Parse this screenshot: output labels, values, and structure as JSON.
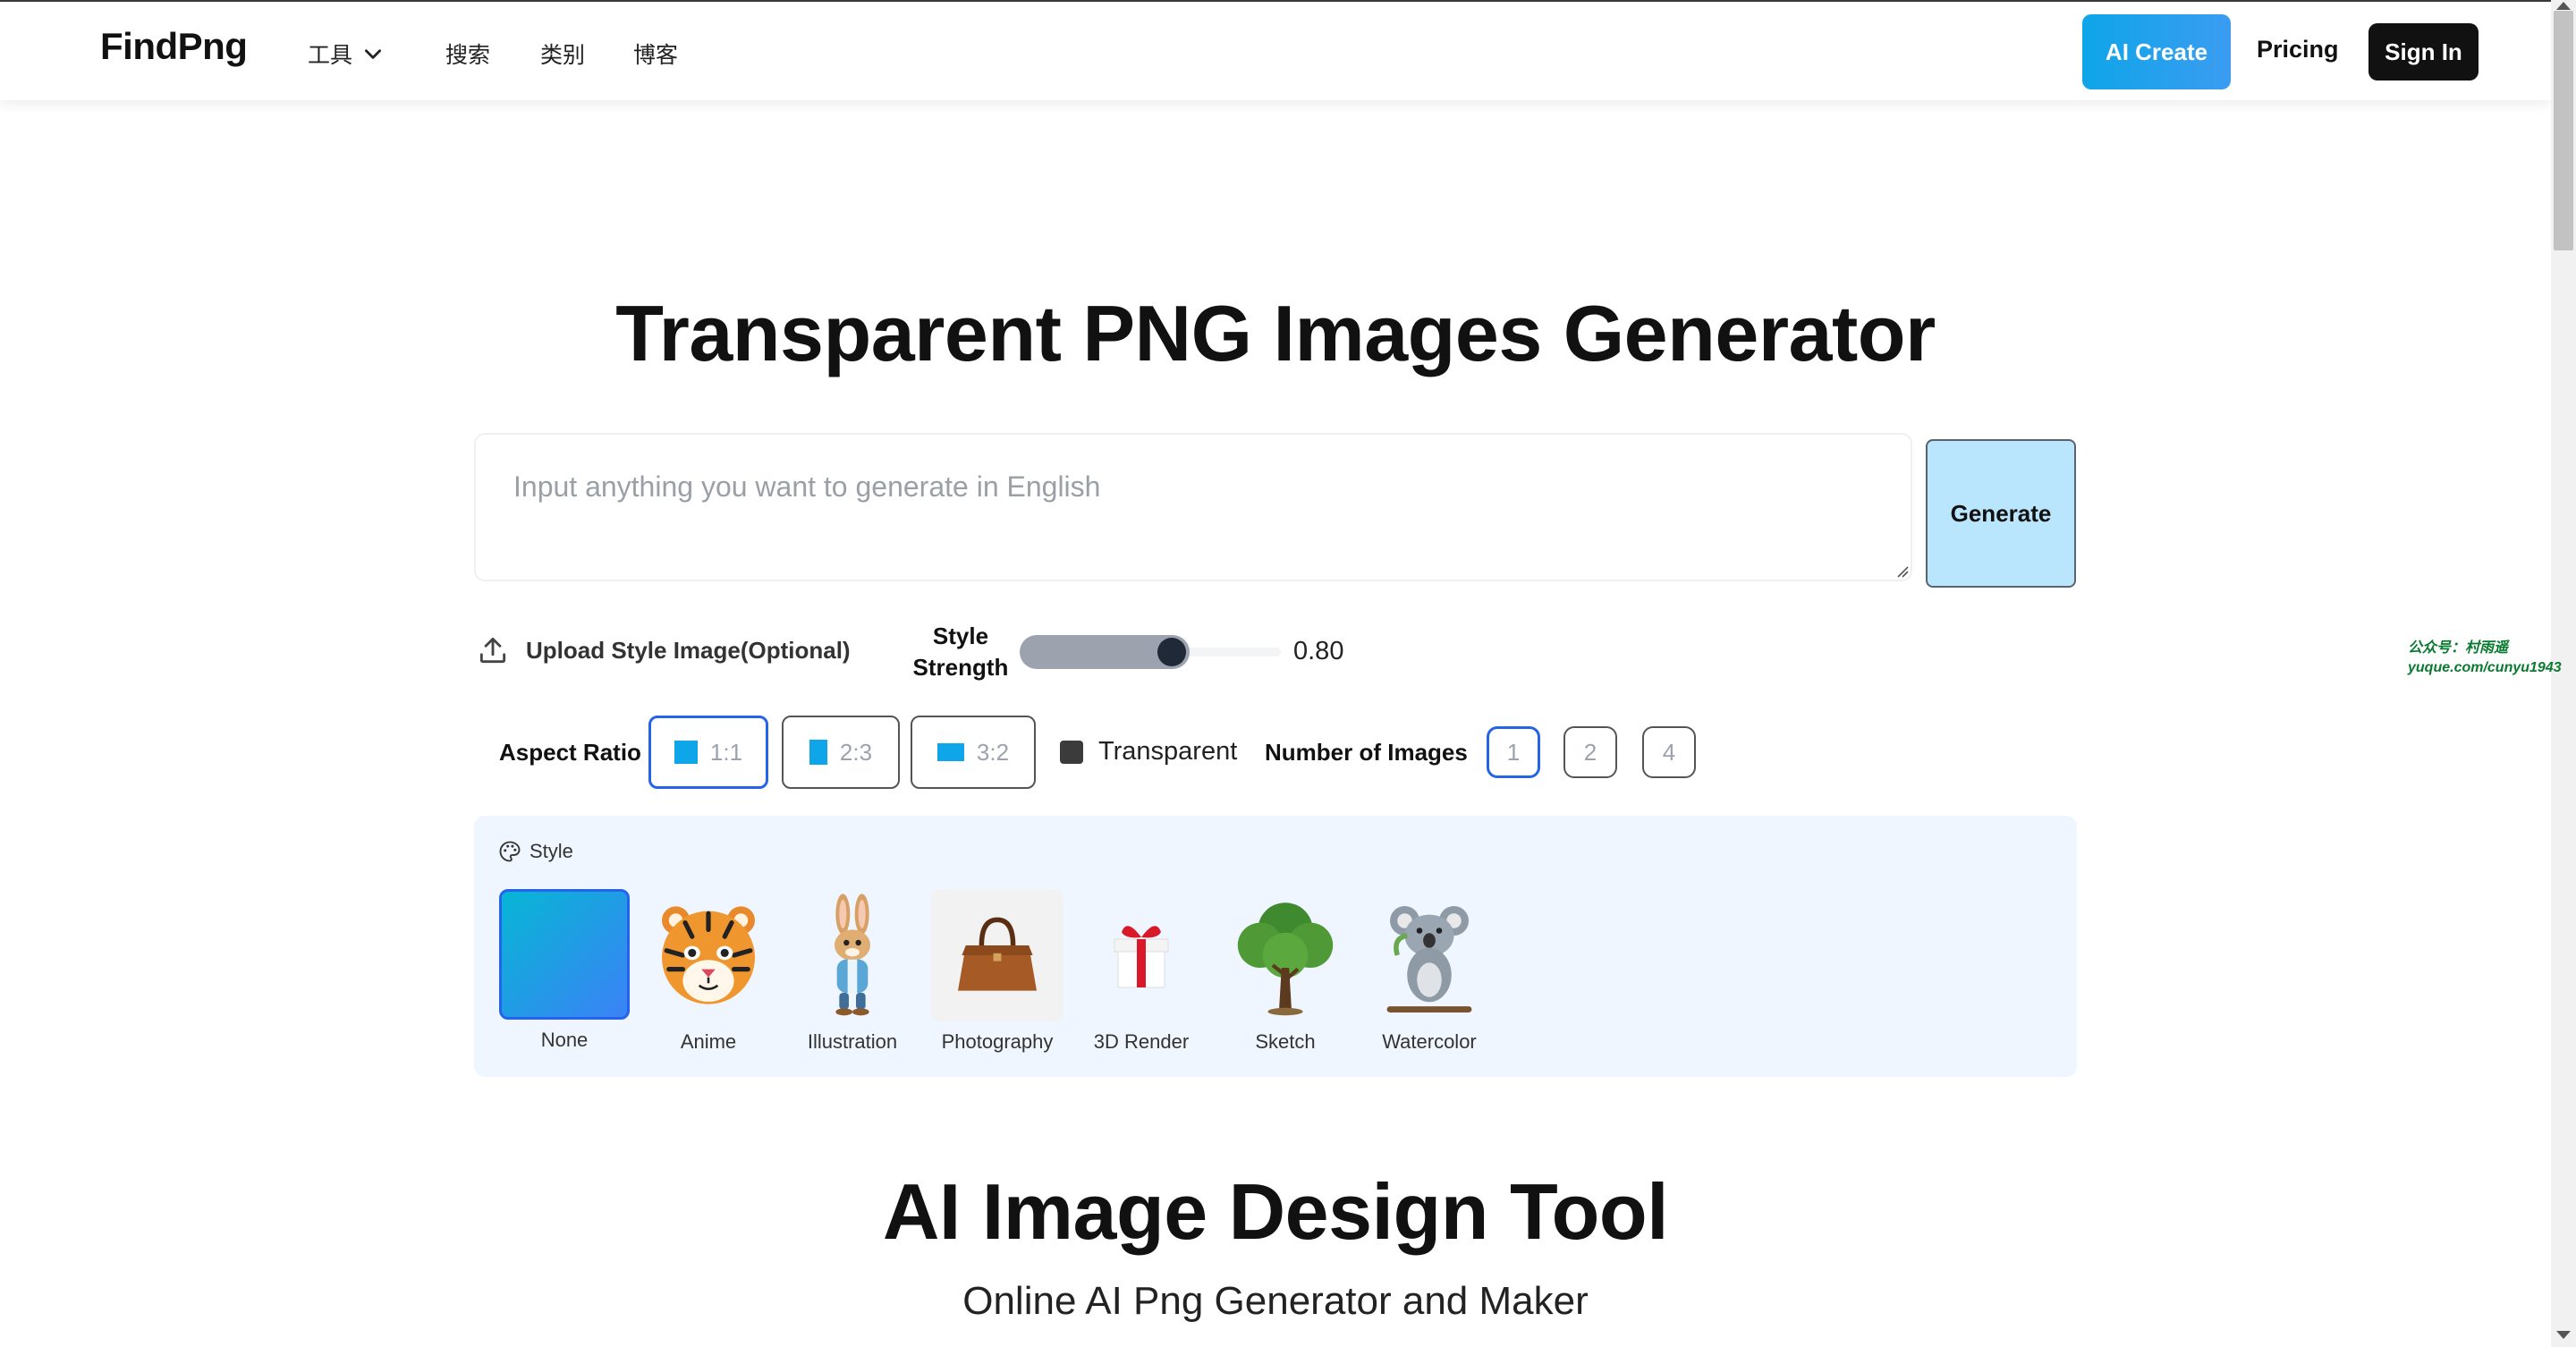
{
  "header": {
    "logo": "FindPng",
    "nav": [
      {
        "label": "工具"
      },
      {
        "label": "搜索"
      },
      {
        "label": "类别"
      },
      {
        "label": "博客"
      }
    ],
    "ai_create": "AI Create",
    "pricing": "Pricing",
    "sign_in": "Sign In"
  },
  "hero": {
    "title": "Transparent PNG Images Generator",
    "prompt_placeholder": "Input anything you want to generate in English",
    "prompt_value": "",
    "generate": "Generate"
  },
  "controls": {
    "upload_label": "Upload Style Image(Optional)",
    "style_strength_label_1": "Style",
    "style_strength_label_2": "Strength",
    "style_strength_value": 0.8,
    "style_strength_display": "0.80",
    "aspect_ratio_label": "Aspect Ratio",
    "aspect_ratios": [
      "1:1",
      "2:3",
      "3:2"
    ],
    "aspect_ratio_selected": "1:1",
    "transparent_label": "Transparent",
    "transparent_checked": true,
    "num_images_label": "Number of Images",
    "num_images_options": [
      "1",
      "2",
      "4"
    ],
    "num_images_selected": "1"
  },
  "style": {
    "heading": "Style",
    "selected": "None",
    "options": [
      {
        "label": "None",
        "icon": "gradient-swatch"
      },
      {
        "label": "Anime",
        "icon": "tiger-icon"
      },
      {
        "label": "Illustration",
        "icon": "rabbit-icon"
      },
      {
        "label": "Photography",
        "icon": "handbag-icon"
      },
      {
        "label": "3D Render",
        "icon": "gift-box-icon"
      },
      {
        "label": "Sketch",
        "icon": "tree-icon"
      },
      {
        "label": "Watercolor",
        "icon": "koala-icon"
      }
    ]
  },
  "section2": {
    "title": "AI Image Design Tool",
    "subtitle": "Online AI Png Generator and Maker"
  },
  "watermark": {
    "line1": "公众号：村雨遥",
    "line2": "yuque.com/cunyu1943"
  },
  "colors": {
    "accent": "#2563eb",
    "ai_create_from": "#0ea5e9",
    "generate_bg": "#bae6fd",
    "style_panel_bg": "#eff6ff"
  }
}
